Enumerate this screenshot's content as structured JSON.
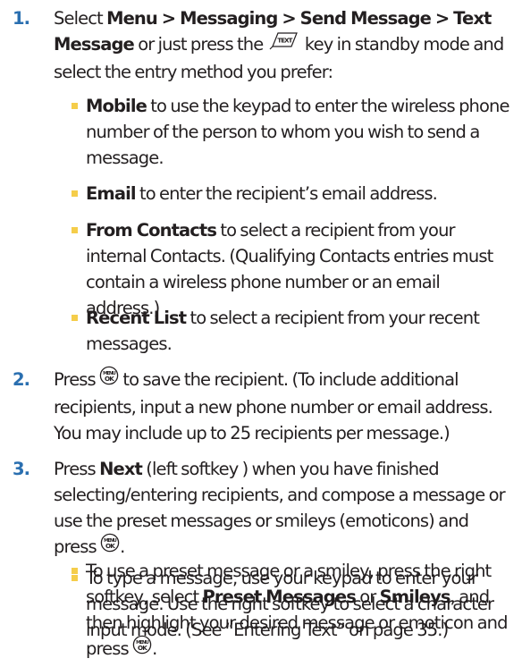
{
  "steps": [
    {
      "number": "1.",
      "pre": "Select ",
      "path": "Menu > Messaging > Send Message > Text Message",
      "mid": " or just press the ",
      "post": " key in standby mode and select the entry method you prefer:",
      "key_icon": "text-key-icon",
      "options": [
        {
          "label": "Mobile",
          "text": " to use the keypad to enter the wireless phone number of the person to whom you wish to send a message."
        },
        {
          "label": "Email",
          "text": " to enter the recipient’s email address."
        },
        {
          "label": "From Contacts",
          "text": " to select a recipient from your internal Contacts. (Qualifying Contacts entries must contain a wireless phone number or an email address.)"
        },
        {
          "label": "Recent List",
          "text": " to select a recipient from your recent messages."
        }
      ]
    },
    {
      "number": "2.",
      "pre": "Press ",
      "post": " to save the recipient. (To include additional recipients, input a new phone number or email address. You may include up to 25 recipients per message.)",
      "key_icon": "menu-ok-key-icon"
    },
    {
      "number": "3.",
      "pre": "Press ",
      "bold": "Next",
      "post": " (left softkey ) when you have finished selecting/entering recipients, and compose a message or use the preset messages or smileys (emoticons) and press ",
      "end": ".",
      "key_icon": "menu-ok-key-icon",
      "options": [
        {
          "text": "To type a message, use your keypad to enter your message. Use the right softkey to select a character input mode. (See “Entering Text” on page 35.)"
        },
        {
          "pre": "To use a preset  message or a smiley, press the right softkey, select ",
          "bold1": "Preset Messages",
          "or": " or ",
          "bold2": "Smileys",
          "post": ", and then highlight your desired message or emoticon and press ",
          "end": "."
        }
      ]
    }
  ],
  "key_labels": {
    "ok_top": "MENU",
    "ok_bottom": "OK",
    "text_key": "TEXT"
  },
  "colors": {
    "step_number": "#2a6fb0",
    "bullet": "#f5cd4a",
    "text": "#231f20"
  }
}
